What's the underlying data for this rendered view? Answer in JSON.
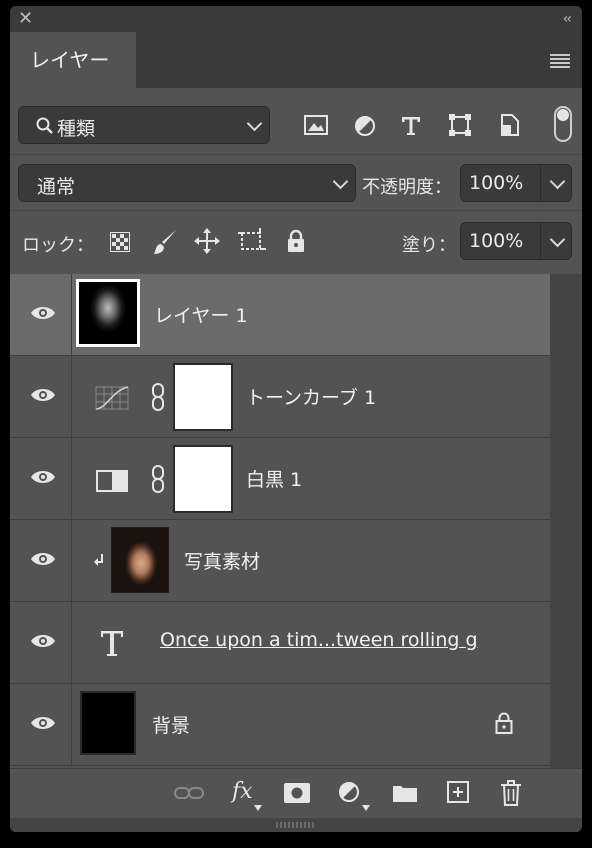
{
  "panel": {
    "tab_label": "レイヤー",
    "icons": [
      "close-icon",
      "collapse-icon",
      "panel-menu-icon"
    ]
  },
  "filter": {
    "kind_label": "種類",
    "filter_icons": [
      "image-filter-icon",
      "adjustment-filter-icon",
      "type-filter-icon",
      "shape-filter-icon",
      "smart-object-filter-icon"
    ]
  },
  "blend": {
    "mode": "通常",
    "opacity_label": "不透明度：",
    "opacity_value": "100%"
  },
  "lock": {
    "label": "ロック：",
    "fill_label": "塗り：",
    "fill_value": "100%",
    "lock_icons": [
      "lock-transparent-icon",
      "lock-image-icon",
      "lock-position-icon",
      "lock-artboard-icon",
      "lock-all-icon"
    ]
  },
  "layers": [
    {
      "name": "レイヤー 1",
      "selected": true
    },
    {
      "name": "トーンカーブ 1",
      "selected": false
    },
    {
      "name": "白黒 1",
      "selected": false
    },
    {
      "name": "写真素材",
      "selected": false,
      "clipped": true
    },
    {
      "name": "Once upon a tim...tween rolling g",
      "selected": false
    },
    {
      "name": "背景",
      "selected": false,
      "locked": true
    }
  ],
  "footer": {
    "icons": [
      "link-layers-icon",
      "fx-icon",
      "mask-icon",
      "adjustment-layer-icon",
      "group-folder-icon",
      "new-layer-icon",
      "trash-icon"
    ],
    "fx_text": "fx"
  },
  "colors": {
    "panel": "#535353",
    "dark": "#3a3a3a",
    "selected_row": "#6b6b6b"
  }
}
